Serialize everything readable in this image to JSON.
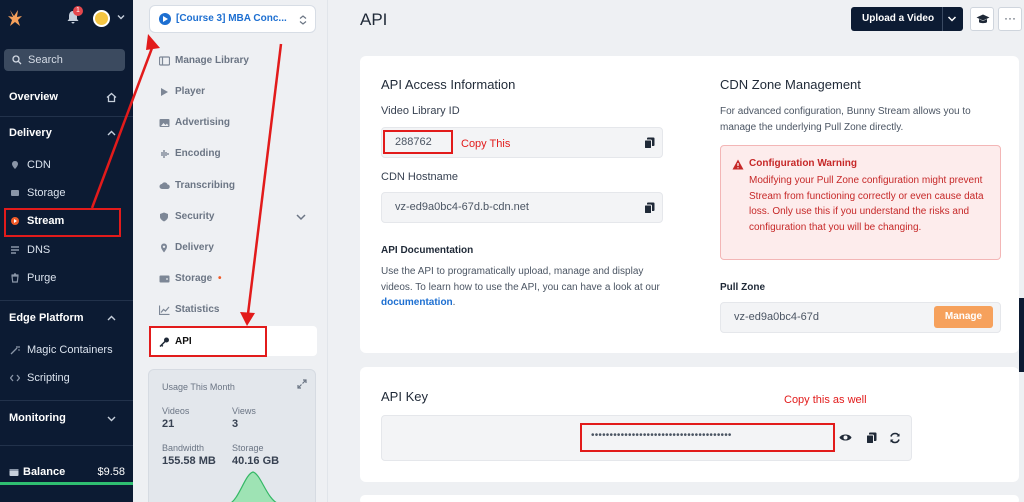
{
  "sidebar": {
    "notification_count": "1",
    "search_placeholder": "Search",
    "sections": {
      "overview": "Overview",
      "delivery": "Delivery",
      "edge_platform": "Edge Platform",
      "monitoring": "Monitoring"
    },
    "delivery_items": [
      "CDN",
      "Storage",
      "Stream",
      "DNS",
      "Purge"
    ],
    "edge_items": [
      "Magic Containers",
      "Scripting"
    ],
    "balance_label": "Balance",
    "balance_value": "$9.58"
  },
  "subnav": {
    "library_selector": "[Course 3] MBA Conc...",
    "items": [
      "Manage Library",
      "Player",
      "Advertising",
      "Encoding",
      "Transcribing",
      "Security",
      "Delivery",
      "Storage",
      "Statistics"
    ],
    "storage_indicator": "•",
    "active_item": "API",
    "usage": {
      "title": "Usage This Month",
      "videos_label": "Videos",
      "videos_value": "21",
      "views_label": "Views",
      "views_value": "3",
      "bandwidth_label": "Bandwidth",
      "bandwidth_value": "155.58 MB",
      "storage_label": "Storage",
      "storage_value": "40.16 GB"
    }
  },
  "header": {
    "page_title": "API",
    "upload_label": "Upload a Video",
    "more_label": "···"
  },
  "api_access": {
    "title": "API Access Information",
    "library_id_label": "Video Library ID",
    "library_id_value": "288762",
    "hostname_label": "CDN Hostname",
    "hostname_value": "vz-ed9a0bc4-67d.b-cdn.net",
    "doc_label": "API Documentation",
    "doc_text": "Use the API to programatically upload, manage and display videos. To learn how to use the API, you can have a look at our ",
    "doc_link": "documentation",
    "doc_tail": "."
  },
  "cdn_zone": {
    "title": "CDN Zone Management",
    "description": "For advanced configuration, Bunny Stream allows you to manage the underlying Pull Zone directly.",
    "warning_title": "Configuration Warning",
    "warning_text": "Modifying your Pull Zone configuration might prevent Stream from functioning correctly or even cause data loss. Only use this if you understand the risks and configuration that you will be changing.",
    "pull_zone_label": "Pull Zone",
    "pull_zone_value": "vz-ed9a0bc4-67d",
    "manage_label": "Manage"
  },
  "api_key": {
    "title": "API Key",
    "masked_value": "••••••••••••••••••••••••••••••••••••••"
  },
  "annotations": {
    "copy_this": "Copy This",
    "copy_this_as_well": "Copy this as well"
  },
  "colors": {
    "sidebar_bg": "#0c1b33",
    "accent_blue": "#1d6fd1",
    "manage_orange": "#f6a15c",
    "warning_red": "#c62828",
    "annotation_red": "#e21b1b"
  }
}
